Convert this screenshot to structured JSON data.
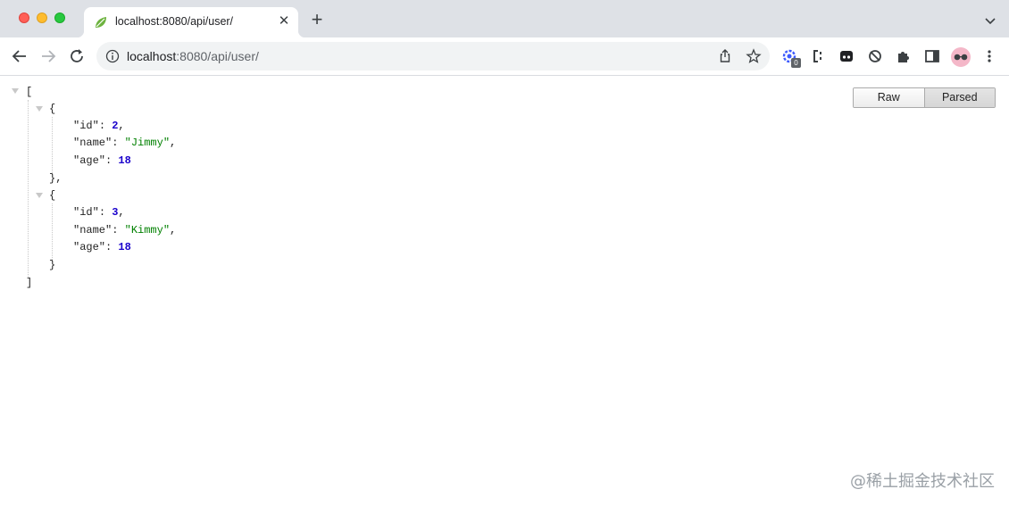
{
  "browser": {
    "tab_title": "localhost:8080/api/user/",
    "url_host": "localhost",
    "url_rest": ":8080/api/user/",
    "extension_badge": "0",
    "icons": [
      "back-icon",
      "forward-icon",
      "reload-icon",
      "info-icon",
      "share-icon",
      "bookmark-star-icon",
      "extension-icon",
      "puzzle-icon",
      "side-panel-icon",
      "kebab-menu-icon"
    ]
  },
  "json_view": {
    "open_bracket": "[",
    "close_bracket": "]",
    "open_brace": "{",
    "close_brace_comma": "},",
    "close_brace": "}",
    "records": [
      {
        "id_key": "\"id\"",
        "id_val": "2",
        "name_key": "\"name\"",
        "name_val": "\"Jimmy\"",
        "age_key": "\"age\"",
        "age_val": "18"
      },
      {
        "id_key": "\"id\"",
        "id_val": "3",
        "name_key": "\"name\"",
        "name_val": "\"Kimmy\"",
        "age_key": "\"age\"",
        "age_val": "18"
      }
    ],
    "raw_label": "Raw",
    "parsed_label": "Parsed",
    "active_mode": "Parsed"
  },
  "watermark": "@稀土掘金技术社区"
}
